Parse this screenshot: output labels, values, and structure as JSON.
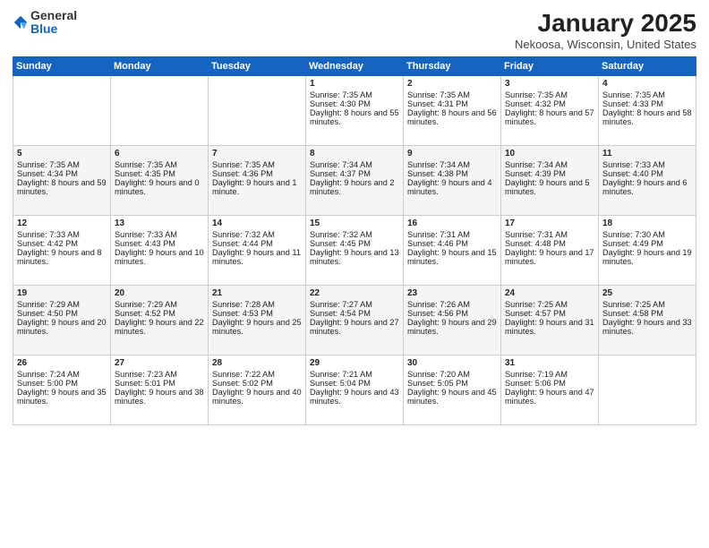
{
  "logo": {
    "general": "General",
    "blue": "Blue"
  },
  "header": {
    "month": "January 2025",
    "location": "Nekoosa, Wisconsin, United States"
  },
  "days_of_week": [
    "Sunday",
    "Monday",
    "Tuesday",
    "Wednesday",
    "Thursday",
    "Friday",
    "Saturday"
  ],
  "weeks": [
    [
      {
        "day": "",
        "content": ""
      },
      {
        "day": "",
        "content": ""
      },
      {
        "day": "",
        "content": ""
      },
      {
        "day": "1",
        "content": "Sunrise: 7:35 AM\nSunset: 4:30 PM\nDaylight: 8 hours and 55 minutes."
      },
      {
        "day": "2",
        "content": "Sunrise: 7:35 AM\nSunset: 4:31 PM\nDaylight: 8 hours and 56 minutes."
      },
      {
        "day": "3",
        "content": "Sunrise: 7:35 AM\nSunset: 4:32 PM\nDaylight: 8 hours and 57 minutes."
      },
      {
        "day": "4",
        "content": "Sunrise: 7:35 AM\nSunset: 4:33 PM\nDaylight: 8 hours and 58 minutes."
      }
    ],
    [
      {
        "day": "5",
        "content": "Sunrise: 7:35 AM\nSunset: 4:34 PM\nDaylight: 8 hours and 59 minutes."
      },
      {
        "day": "6",
        "content": "Sunrise: 7:35 AM\nSunset: 4:35 PM\nDaylight: 9 hours and 0 minutes."
      },
      {
        "day": "7",
        "content": "Sunrise: 7:35 AM\nSunset: 4:36 PM\nDaylight: 9 hours and 1 minute."
      },
      {
        "day": "8",
        "content": "Sunrise: 7:34 AM\nSunset: 4:37 PM\nDaylight: 9 hours and 2 minutes."
      },
      {
        "day": "9",
        "content": "Sunrise: 7:34 AM\nSunset: 4:38 PM\nDaylight: 9 hours and 4 minutes."
      },
      {
        "day": "10",
        "content": "Sunrise: 7:34 AM\nSunset: 4:39 PM\nDaylight: 9 hours and 5 minutes."
      },
      {
        "day": "11",
        "content": "Sunrise: 7:33 AM\nSunset: 4:40 PM\nDaylight: 9 hours and 6 minutes."
      }
    ],
    [
      {
        "day": "12",
        "content": "Sunrise: 7:33 AM\nSunset: 4:42 PM\nDaylight: 9 hours and 8 minutes."
      },
      {
        "day": "13",
        "content": "Sunrise: 7:33 AM\nSunset: 4:43 PM\nDaylight: 9 hours and 10 minutes."
      },
      {
        "day": "14",
        "content": "Sunrise: 7:32 AM\nSunset: 4:44 PM\nDaylight: 9 hours and 11 minutes."
      },
      {
        "day": "15",
        "content": "Sunrise: 7:32 AM\nSunset: 4:45 PM\nDaylight: 9 hours and 13 minutes."
      },
      {
        "day": "16",
        "content": "Sunrise: 7:31 AM\nSunset: 4:46 PM\nDaylight: 9 hours and 15 minutes."
      },
      {
        "day": "17",
        "content": "Sunrise: 7:31 AM\nSunset: 4:48 PM\nDaylight: 9 hours and 17 minutes."
      },
      {
        "day": "18",
        "content": "Sunrise: 7:30 AM\nSunset: 4:49 PM\nDaylight: 9 hours and 19 minutes."
      }
    ],
    [
      {
        "day": "19",
        "content": "Sunrise: 7:29 AM\nSunset: 4:50 PM\nDaylight: 9 hours and 20 minutes."
      },
      {
        "day": "20",
        "content": "Sunrise: 7:29 AM\nSunset: 4:52 PM\nDaylight: 9 hours and 22 minutes."
      },
      {
        "day": "21",
        "content": "Sunrise: 7:28 AM\nSunset: 4:53 PM\nDaylight: 9 hours and 25 minutes."
      },
      {
        "day": "22",
        "content": "Sunrise: 7:27 AM\nSunset: 4:54 PM\nDaylight: 9 hours and 27 minutes."
      },
      {
        "day": "23",
        "content": "Sunrise: 7:26 AM\nSunset: 4:56 PM\nDaylight: 9 hours and 29 minutes."
      },
      {
        "day": "24",
        "content": "Sunrise: 7:25 AM\nSunset: 4:57 PM\nDaylight: 9 hours and 31 minutes."
      },
      {
        "day": "25",
        "content": "Sunrise: 7:25 AM\nSunset: 4:58 PM\nDaylight: 9 hours and 33 minutes."
      }
    ],
    [
      {
        "day": "26",
        "content": "Sunrise: 7:24 AM\nSunset: 5:00 PM\nDaylight: 9 hours and 35 minutes."
      },
      {
        "day": "27",
        "content": "Sunrise: 7:23 AM\nSunset: 5:01 PM\nDaylight: 9 hours and 38 minutes."
      },
      {
        "day": "28",
        "content": "Sunrise: 7:22 AM\nSunset: 5:02 PM\nDaylight: 9 hours and 40 minutes."
      },
      {
        "day": "29",
        "content": "Sunrise: 7:21 AM\nSunset: 5:04 PM\nDaylight: 9 hours and 43 minutes."
      },
      {
        "day": "30",
        "content": "Sunrise: 7:20 AM\nSunset: 5:05 PM\nDaylight: 9 hours and 45 minutes."
      },
      {
        "day": "31",
        "content": "Sunrise: 7:19 AM\nSunset: 5:06 PM\nDaylight: 9 hours and 47 minutes."
      },
      {
        "day": "",
        "content": ""
      }
    ]
  ]
}
